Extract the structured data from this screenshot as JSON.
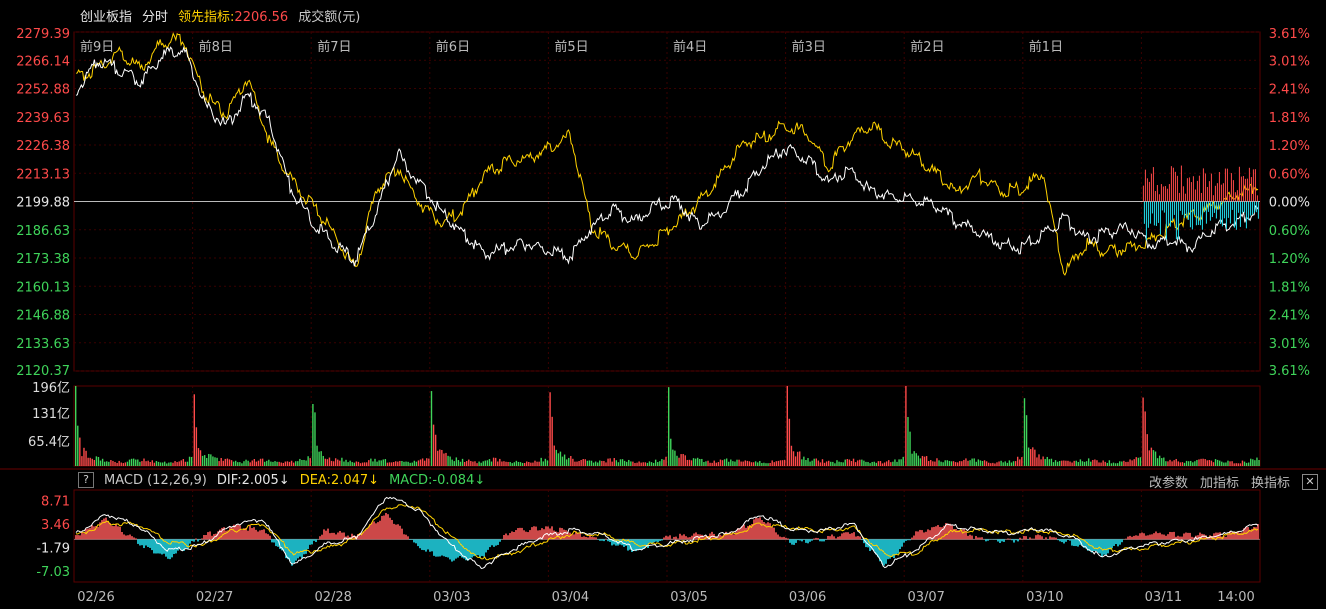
{
  "header": {
    "index_name": "创业板指",
    "mode": "分时",
    "lead_label": "领先指标:",
    "lead_value": "2206.56",
    "volume_label": "成交额(元)"
  },
  "macd_bar": {
    "help": "?",
    "title": "MACD (12,26,9)",
    "dif": "DIF:2.005↓",
    "dea": "DEA:2.047↓",
    "macd": "MACD:-0.084↓",
    "btn_change_params": "改参数",
    "btn_add_indicator": "加指标",
    "btn_switch_indicator": "换指标",
    "btn_close": "✕"
  },
  "colors": {
    "up": "#ff4a4a",
    "down": "#3fd45a",
    "price_line": "#ffffff",
    "lead_line": "#ffd200",
    "macd_up": "#ff5a5a",
    "macd_down": "#24e0f0",
    "grid": "#3a0000"
  },
  "chart_data": {
    "type": "line",
    "price_axis_left": [
      "2279.39",
      "2266.14",
      "2252.88",
      "2239.63",
      "2226.38",
      "2213.13",
      "2199.88",
      "2186.63",
      "2173.38",
      "2160.13",
      "2146.88",
      "2133.63",
      "2120.37"
    ],
    "pct_axis_right": [
      "3.61%",
      "3.01%",
      "2.41%",
      "1.81%",
      "1.20%",
      "0.60%",
      "0.00%",
      "0.60%",
      "1.20%",
      "1.81%",
      "2.41%",
      "3.01%",
      "3.61%"
    ],
    "ylim": [
      2120.37,
      2279.39
    ],
    "prev_close": 2199.88,
    "day_labels": [
      "前9日",
      "前8日",
      "前7日",
      "前6日",
      "前5日",
      "前4日",
      "前3日",
      "前2日",
      "前1日"
    ],
    "dates": [
      "02/26",
      "02/27",
      "02/28",
      "03/03",
      "03/04",
      "03/05",
      "03/06",
      "03/07",
      "03/10",
      "03/11",
      "14:00"
    ],
    "volume_axis": [
      "196亿",
      "131亿",
      "65.4亿"
    ],
    "volume_max": 196,
    "macd_axis": [
      "8.71",
      "3.46",
      "-1.79",
      "-7.03"
    ],
    "macd_ylim": [
      -9.5,
      11
    ],
    "series": [
      {
        "values": [
          2252,
          2266,
          2262,
          2256,
          2268,
          2272,
          2245,
          2235,
          2250,
          2237,
          2206,
          2190,
          2180,
          2172,
          2196,
          2222,
          2208,
          2195,
          2185,
          2175,
          2178,
          2180,
          2177,
          2174,
          2188,
          2196,
          2190,
          2198,
          2200,
          2188,
          2195,
          2205,
          2217,
          2225,
          2220,
          2209,
          2215,
          2204,
          2203,
          2200,
          2198,
          2190,
          2186,
          2180,
          2178,
          2185,
          2192,
          2182,
          2185,
          2188,
          2180,
          2182,
          2178,
          2188,
          2190,
          2196
        ]
      },
      {
        "values": [
          2258,
          2262,
          2270,
          2262,
          2275,
          2276,
          2250,
          2240,
          2258,
          2228,
          2210,
          2198,
          2185,
          2168,
          2206,
          2216,
          2199,
          2190,
          2196,
          2212,
          2218,
          2220,
          2225,
          2231,
          2188,
          2180,
          2175,
          2182,
          2190,
          2200,
          2212,
          2227,
          2230,
          2236,
          2232,
          2216,
          2229,
          2236,
          2227,
          2222,
          2213,
          2204,
          2212,
          2205,
          2206,
          2213,
          2166,
          2180,
          2176,
          2178,
          2182,
          2188,
          2193,
          2198,
          2203,
          2207
        ]
      }
    ],
    "volume_values": [
      140,
      40,
      30,
      22,
      18,
      16,
      14,
      12,
      10,
      12,
      14,
      16,
      15,
      13,
      12,
      11,
      10,
      10,
      11,
      14,
      18,
      22
    ],
    "macd_dif": [
      1.2,
      5.6,
      3.0,
      -2.6,
      -1.4,
      3.1,
      4.6,
      -5.8,
      -1.2,
      0.4,
      9.7,
      6.6,
      -1.0,
      -6.3,
      -2.4,
      0.6,
      2.1,
      0.9,
      -2.3,
      -1.0,
      0.2,
      1.3,
      5.6,
      2.2,
      1.9,
      3.5,
      -6.0,
      -2.4,
      3.1,
      2.1,
      1.4,
      2.4,
      0.6,
      -4.1,
      -1.8,
      -0.6,
      0.0,
      1.3,
      3.4
    ],
    "macd_dea": [
      0.8,
      3.6,
      3.3,
      -0.6,
      -1.6,
      1.8,
      3.6,
      -3.2,
      -2.1,
      0.1,
      7.1,
      7.4,
      1.0,
      -4.5,
      -3.2,
      -0.6,
      1.4,
      1.0,
      -1.1,
      -1.2,
      -0.3,
      0.8,
      3.4,
      2.6,
      1.9,
      2.7,
      -3.4,
      -3.1,
      1.5,
      2.0,
      1.6,
      2.0,
      1.0,
      -2.5,
      -2.3,
      -1.2,
      -0.4,
      0.8,
      2.0
    ]
  }
}
